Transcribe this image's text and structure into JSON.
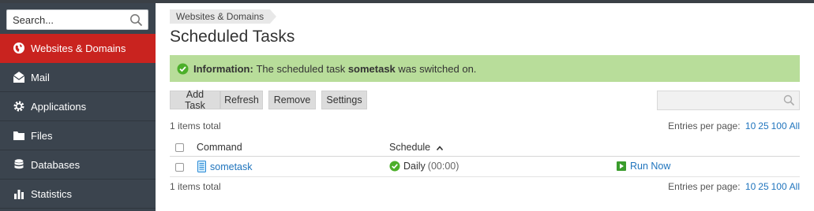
{
  "sidebar": {
    "search_placeholder": "Search...",
    "items": [
      {
        "label": "Websites & Domains",
        "icon": "globe-icon",
        "active": true
      },
      {
        "label": "Mail",
        "icon": "mail-icon"
      },
      {
        "label": "Applications",
        "icon": "gear-icon"
      },
      {
        "label": "Files",
        "icon": "folder-icon"
      },
      {
        "label": "Databases",
        "icon": "database-icon"
      },
      {
        "label": "Statistics",
        "icon": "bar-chart-icon"
      }
    ]
  },
  "breadcrumb": [
    "Websites & Domains"
  ],
  "page_title": "Scheduled Tasks",
  "message": {
    "label": "Information:",
    "text_before": "The scheduled task",
    "task": "sometask",
    "text_after": "was switched on."
  },
  "toolbar": {
    "add_label": "Add Task",
    "refresh_label": "Refresh",
    "remove_label": "Remove",
    "settings_label": "Settings"
  },
  "list": {
    "total_text": "1 items total",
    "entries_label": "Entries per page:",
    "page_sizes": [
      "10",
      "25",
      "100",
      "All"
    ],
    "columns": {
      "command": "Command",
      "schedule": "Schedule"
    },
    "rows": [
      {
        "command": "sometask",
        "schedule": "Daily",
        "time": "(00:00)",
        "action": "Run Now"
      }
    ]
  },
  "colors": {
    "sidebar_bg": "#3b444e",
    "active_bg": "#c9231f",
    "info_bg": "#b8dd9a",
    "link": "#1f74bd",
    "ok_green": "#4caf2a"
  }
}
